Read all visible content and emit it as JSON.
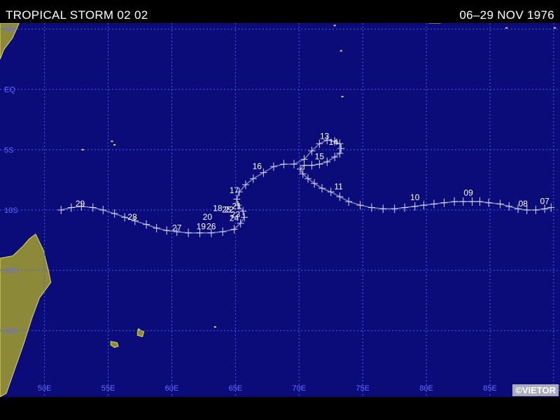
{
  "header": {
    "title": "TROPICAL STORM 02 02",
    "dates": "06–29 NOV 1976"
  },
  "credit": "©VIETOR",
  "colors": {
    "ocean": "#0b0b7a",
    "grid": "#4a5cf0",
    "land": "#8c8a38",
    "coast": "#e0dc50",
    "track": "#7a7ac0",
    "axis_labels": "#6a6aff"
  },
  "map": {
    "lon_range": [
      46.5,
      90.5
    ],
    "lat_range": [
      -25.5,
      5.5
    ],
    "lon_ticks": [
      50,
      55,
      60,
      65,
      70,
      75,
      80,
      85,
      90
    ],
    "lon_labels": [
      "50E",
      "55E",
      "60E",
      "65E",
      "70E",
      "75E",
      "80E",
      "85E",
      "90E"
    ],
    "lat_ticks": [
      5,
      0,
      -5,
      -10,
      -15,
      -20
    ],
    "lat_labels": [
      "5N",
      "EQ",
      "5S",
      "10S",
      "15S",
      "20S"
    ]
  },
  "track": {
    "points": [
      [
        89.8,
        -9.8
      ],
      [
        89.3,
        -9.9
      ],
      [
        88.6,
        -10.0
      ],
      [
        87.9,
        -10.0
      ],
      [
        87.2,
        -9.9
      ],
      [
        86.5,
        -9.7
      ],
      [
        85.8,
        -9.5
      ],
      [
        84.9,
        -9.4
      ],
      [
        84.2,
        -9.3
      ],
      [
        83.6,
        -9.3
      ],
      [
        82.9,
        -9.3
      ],
      [
        82.2,
        -9.3
      ],
      [
        81.4,
        -9.4
      ],
      [
        80.6,
        -9.5
      ],
      [
        79.8,
        -9.6
      ],
      [
        79.1,
        -9.7
      ],
      [
        78.3,
        -9.8
      ],
      [
        77.5,
        -9.9
      ],
      [
        76.6,
        -9.9
      ],
      [
        75.7,
        -9.8
      ],
      [
        74.8,
        -9.6
      ],
      [
        73.9,
        -9.3
      ],
      [
        73.2,
        -8.9
      ],
      [
        72.5,
        -8.5
      ],
      [
        71.8,
        -8.2
      ],
      [
        71.2,
        -7.8
      ],
      [
        70.7,
        -7.4
      ],
      [
        70.3,
        -7.0
      ],
      [
        70.1,
        -6.6
      ],
      [
        70.4,
        -6.3
      ],
      [
        71.0,
        -6.3
      ],
      [
        71.6,
        -6.2
      ],
      [
        72.2,
        -6.0
      ],
      [
        72.8,
        -5.6
      ],
      [
        73.2,
        -5.3
      ],
      [
        73.3,
        -4.9
      ],
      [
        73.2,
        -4.5
      ],
      [
        72.8,
        -4.3
      ],
      [
        72.2,
        -4.2
      ],
      [
        71.6,
        -4.5
      ],
      [
        71.0,
        -5.1
      ],
      [
        70.4,
        -5.8
      ],
      [
        69.6,
        -6.2
      ],
      [
        68.8,
        -6.2
      ],
      [
        68.0,
        -6.4
      ],
      [
        67.2,
        -6.9
      ],
      [
        66.4,
        -7.4
      ],
      [
        65.8,
        -7.9
      ],
      [
        65.3,
        -8.5
      ],
      [
        65.1,
        -9.1
      ],
      [
        65.2,
        -9.6
      ],
      [
        65.6,
        -10.1
      ],
      [
        65.7,
        -10.6
      ],
      [
        65.4,
        -11.1
      ],
      [
        64.9,
        -11.6
      ],
      [
        64.0,
        -11.8
      ],
      [
        63.1,
        -11.9
      ],
      [
        62.2,
        -11.9
      ],
      [
        61.3,
        -11.9
      ],
      [
        60.4,
        -11.8
      ],
      [
        59.6,
        -11.7
      ],
      [
        58.8,
        -11.5
      ],
      [
        58.0,
        -11.2
      ],
      [
        57.1,
        -10.9
      ],
      [
        56.3,
        -10.6
      ],
      [
        55.5,
        -10.3
      ],
      [
        54.6,
        -10.0
      ],
      [
        53.8,
        -9.8
      ],
      [
        52.9,
        -9.7
      ],
      [
        52.1,
        -9.8
      ],
      [
        51.3,
        -10.0
      ]
    ],
    "labels": [
      {
        "text": "07",
        "lon": 89.3,
        "lat": -9.5
      },
      {
        "text": "08",
        "lon": 87.6,
        "lat": -9.7
      },
      {
        "text": "09",
        "lon": 83.3,
        "lat": -8.8
      },
      {
        "text": "10",
        "lon": 79.1,
        "lat": -9.2
      },
      {
        "text": "11",
        "lon": 73.1,
        "lat": -8.3
      },
      {
        "text": "13",
        "lon": 72.0,
        "lat": -4.1
      },
      {
        "text": "14",
        "lon": 72.7,
        "lat": -4.6
      },
      {
        "text": "15",
        "lon": 71.6,
        "lat": -5.8
      },
      {
        "text": "16",
        "lon": 66.7,
        "lat": -6.6
      },
      {
        "text": "17",
        "lon": 64.9,
        "lat": -8.6
      },
      {
        "text": "18",
        "lon": 63.6,
        "lat": -10.1
      },
      {
        "text": "19",
        "lon": 62.3,
        "lat": -11.6
      },
      {
        "text": "20",
        "lon": 62.8,
        "lat": -10.8
      },
      {
        "text": "21",
        "lon": 65.1,
        "lat": -9.9
      },
      {
        "text": "22",
        "lon": 64.5,
        "lat": -10.2
      },
      {
        "text": "23",
        "lon": 65.0,
        "lat": -10.6
      },
      {
        "text": "24",
        "lon": 64.9,
        "lat": -10.9
      },
      {
        "text": "25",
        "lon": 64.3,
        "lat": -10.2
      },
      {
        "text": "26",
        "lon": 63.1,
        "lat": -11.6
      },
      {
        "text": "27",
        "lon": 60.4,
        "lat": -11.7
      },
      {
        "text": "28",
        "lon": 56.9,
        "lat": -10.8
      },
      {
        "text": "29",
        "lon": 52.8,
        "lat": -9.7
      }
    ]
  },
  "land": [
    {
      "name": "Madagascar",
      "coords": [
        [
          49.3,
          -12.0
        ],
        [
          49.9,
          -13.3
        ],
        [
          50.3,
          -15.0
        ],
        [
          50.5,
          -16.0
        ],
        [
          49.6,
          -17.3
        ],
        [
          49.0,
          -19.0
        ],
        [
          48.4,
          -21.0
        ],
        [
          47.8,
          -22.8
        ],
        [
          47.0,
          -25.2
        ],
        [
          46.5,
          -25.5
        ],
        [
          46.5,
          -14.0
        ],
        [
          47.5,
          -13.8
        ],
        [
          48.3,
          -13.0
        ],
        [
          48.8,
          -12.4
        ]
      ]
    },
    {
      "name": "Africa",
      "coords": [
        [
          46.5,
          5.5
        ],
        [
          48.0,
          5.5
        ],
        [
          47.5,
          4.3
        ],
        [
          46.8,
          3.3
        ],
        [
          46.5,
          2.5
        ]
      ]
    },
    {
      "name": "Sri Lanka",
      "coords": [
        [
          79.8,
          6.0
        ],
        [
          80.2,
          5.5
        ],
        [
          81.1,
          5.5
        ],
        [
          81.6,
          6.0
        ],
        [
          81.8,
          7.0
        ],
        [
          81.3,
          8.3
        ],
        [
          80.8,
          9.0
        ],
        [
          80.2,
          9.8
        ],
        [
          79.9,
          9.0
        ],
        [
          79.7,
          7.5
        ]
      ]
    },
    {
      "name": "Reunion",
      "coords": [
        [
          55.2,
          -20.9
        ],
        [
          55.7,
          -21.0
        ],
        [
          55.8,
          -21.3
        ],
        [
          55.5,
          -21.4
        ],
        [
          55.2,
          -21.2
        ]
      ]
    },
    {
      "name": "Mauritius",
      "coords": [
        [
          57.4,
          -19.9
        ],
        [
          57.8,
          -20.1
        ],
        [
          57.7,
          -20.5
        ],
        [
          57.3,
          -20.4
        ],
        [
          57.3,
          -20.1
        ]
      ]
    }
  ],
  "islets": [
    [
      55.5,
      -4.6
    ],
    [
      55.3,
      -4.3
    ],
    [
      57.4,
      -19.9
    ],
    [
      63.4,
      -19.7
    ],
    [
      73.4,
      -0.6
    ],
    [
      73.3,
      3.2
    ],
    [
      72.8,
      5.3
    ],
    [
      86.3,
      5.1
    ],
    [
      90.1,
      5.1
    ],
    [
      53.0,
      -5.0
    ]
  ]
}
